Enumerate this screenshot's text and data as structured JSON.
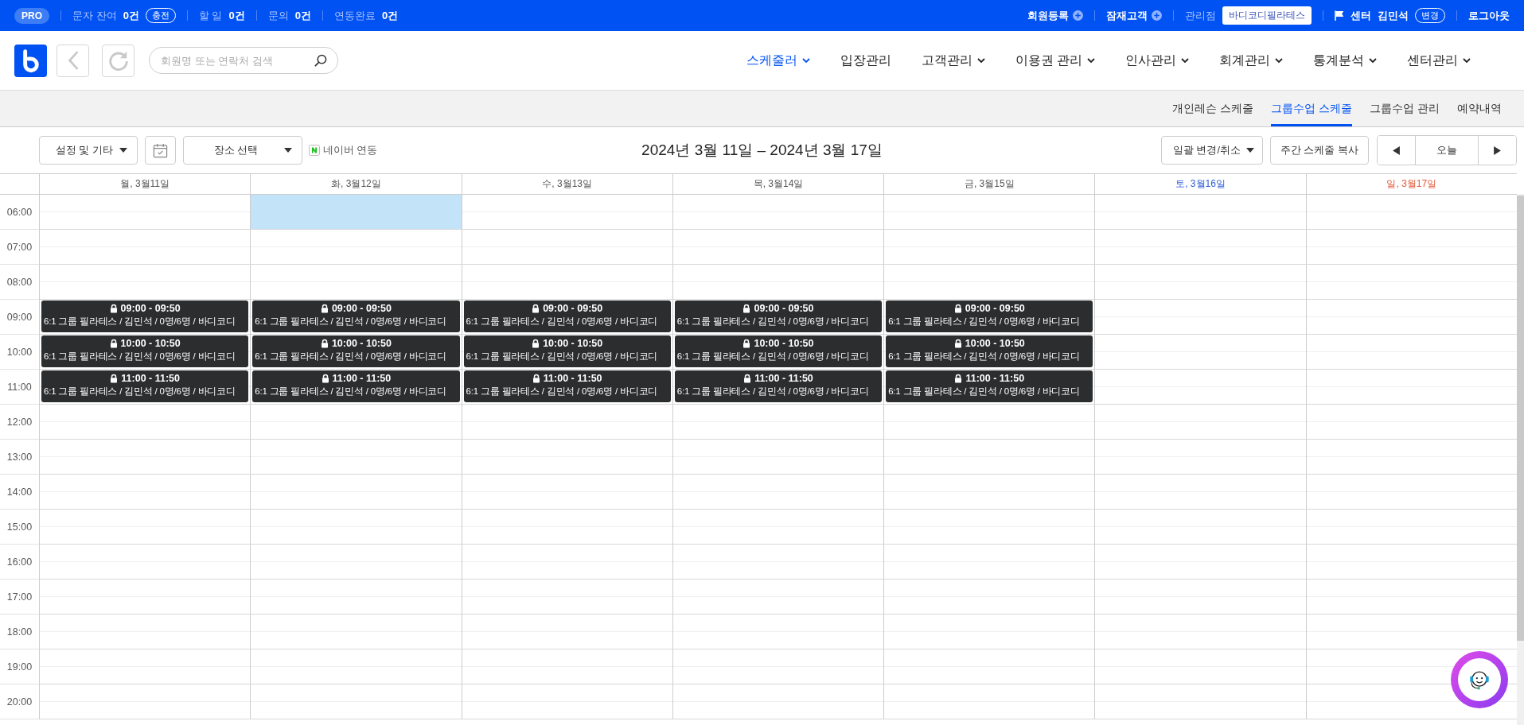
{
  "topbar": {
    "badge": "PRO",
    "stats": [
      {
        "label": "문자 잔여",
        "value": "0건",
        "action": "충전"
      },
      {
        "label": "할 일",
        "value": "0건"
      },
      {
        "label": "문의",
        "value": "0건"
      },
      {
        "label": "연동완료",
        "value": "0건"
      }
    ],
    "links": [
      {
        "label": "회원등록"
      },
      {
        "label": "잠재고객"
      }
    ],
    "branch": {
      "label": "관리점",
      "value": "바디코디필라테스"
    },
    "user": {
      "center": "센터",
      "name": "김민석",
      "action": "변경"
    },
    "logout": "로그아웃"
  },
  "search": {
    "placeholder": "회원명 또는 연락처 검색"
  },
  "nav": [
    {
      "label": "스케줄러",
      "dropdown": true,
      "selected": true
    },
    {
      "label": "입장관리",
      "dropdown": false,
      "selected": false
    },
    {
      "label": "고객관리",
      "dropdown": true,
      "selected": false
    },
    {
      "label": "이용권 관리",
      "dropdown": true,
      "selected": false
    },
    {
      "label": "인사관리",
      "dropdown": true,
      "selected": false
    },
    {
      "label": "회계관리",
      "dropdown": true,
      "selected": false
    },
    {
      "label": "통계분석",
      "dropdown": true,
      "selected": false
    },
    {
      "label": "센터관리",
      "dropdown": true,
      "selected": false
    }
  ],
  "subtabs": [
    {
      "label": "개인레슨 스케줄",
      "selected": false
    },
    {
      "label": "그룹수업 스케줄",
      "selected": true
    },
    {
      "label": "그룹수업 관리",
      "selected": false
    },
    {
      "label": "예약내역",
      "selected": false
    }
  ],
  "toolbar": {
    "settings": "설정 및 기타",
    "place": "장소 선택",
    "naver": "네이버 연동",
    "range": "2024년 3월 11일 – 2024년 3월 17일",
    "bulk": "일괄 변경/취소",
    "copy": "주간 스케줄 복사",
    "today": "오늘"
  },
  "days": [
    {
      "label": "월, 3월11일",
      "kind": "weekday"
    },
    {
      "label": "화, 3월12일",
      "kind": "weekday"
    },
    {
      "label": "수, 3월13일",
      "kind": "weekday"
    },
    {
      "label": "목, 3월14일",
      "kind": "weekday"
    },
    {
      "label": "금, 3월15일",
      "kind": "weekday"
    },
    {
      "label": "토, 3월16일",
      "kind": "saturday"
    },
    {
      "label": "일, 3월17일",
      "kind": "sunday"
    }
  ],
  "hours": [
    {
      "label": "06:00",
      "cells": [
        {
          "selected": false
        },
        {
          "selected": true
        },
        {
          "selected": false
        },
        {
          "selected": false
        },
        {
          "selected": false
        },
        {
          "selected": false
        },
        {
          "selected": false
        }
      ]
    },
    {
      "label": "07:00",
      "cells": [
        {
          "selected": false
        },
        {
          "selected": false
        },
        {
          "selected": false
        },
        {
          "selected": false
        },
        {
          "selected": false
        },
        {
          "selected": false
        },
        {
          "selected": false
        }
      ]
    },
    {
      "label": "08:00",
      "cells": [
        {
          "selected": false
        },
        {
          "selected": false
        },
        {
          "selected": false
        },
        {
          "selected": false
        },
        {
          "selected": false
        },
        {
          "selected": false
        },
        {
          "selected": false
        }
      ]
    },
    {
      "label": "09:00",
      "cells": [
        {
          "selected": false,
          "event": {
            "time": "09:00 - 09:50",
            "title": "6:1 그룹 필라테스 / 김민석 / 0명/6명 / 바디코디",
            "locked": true
          }
        },
        {
          "selected": false,
          "event": {
            "time": "09:00 - 09:50",
            "title": "6:1 그룹 필라테스 / 김민석 / 0명/6명 / 바디코디",
            "locked": true
          }
        },
        {
          "selected": false,
          "event": {
            "time": "09:00 - 09:50",
            "title": "6:1 그룹 필라테스 / 김민석 / 0명/6명 / 바디코디",
            "locked": true
          }
        },
        {
          "selected": false,
          "event": {
            "time": "09:00 - 09:50",
            "title": "6:1 그룹 필라테스 / 김민석 / 0명/6명 / 바디코디",
            "locked": true
          }
        },
        {
          "selected": false,
          "event": {
            "time": "09:00 - 09:50",
            "title": "6:1 그룹 필라테스 / 김민석 / 0명/6명 / 바디코디",
            "locked": true
          }
        },
        {
          "selected": false
        },
        {
          "selected": false
        }
      ]
    },
    {
      "label": "10:00",
      "cells": [
        {
          "selected": false,
          "event": {
            "time": "10:00 - 10:50",
            "title": "6:1 그룹 필라테스 / 김민석 / 0명/6명 / 바디코디",
            "locked": true
          }
        },
        {
          "selected": false,
          "event": {
            "time": "10:00 - 10:50",
            "title": "6:1 그룹 필라테스 / 김민석 / 0명/6명 / 바디코디",
            "locked": true
          }
        },
        {
          "selected": false,
          "event": {
            "time": "10:00 - 10:50",
            "title": "6:1 그룹 필라테스 / 김민석 / 0명/6명 / 바디코디",
            "locked": true
          }
        },
        {
          "selected": false,
          "event": {
            "time": "10:00 - 10:50",
            "title": "6:1 그룹 필라테스 / 김민석 / 0명/6명 / 바디코디",
            "locked": true
          }
        },
        {
          "selected": false,
          "event": {
            "time": "10:00 - 10:50",
            "title": "6:1 그룹 필라테스 / 김민석 / 0명/6명 / 바디코디",
            "locked": true
          }
        },
        {
          "selected": false
        },
        {
          "selected": false
        }
      ]
    },
    {
      "label": "11:00",
      "cells": [
        {
          "selected": false,
          "event": {
            "time": "11:00 - 11:50",
            "title": "6:1 그룹 필라테스 / 김민석 / 0명/6명 / 바디코디",
            "locked": true
          }
        },
        {
          "selected": false,
          "event": {
            "time": "11:00 - 11:50",
            "title": "6:1 그룹 필라테스 / 김민석 / 0명/6명 / 바디코디",
            "locked": true
          }
        },
        {
          "selected": false,
          "event": {
            "time": "11:00 - 11:50",
            "title": "6:1 그룹 필라테스 / 김민석 / 0명/6명 / 바디코디",
            "locked": true
          }
        },
        {
          "selected": false,
          "event": {
            "time": "11:00 - 11:50",
            "title": "6:1 그룹 필라테스 / 김민석 / 0명/6명 / 바디코디",
            "locked": true
          }
        },
        {
          "selected": false,
          "event": {
            "time": "11:00 - 11:50",
            "title": "6:1 그룹 필라테스 / 김민석 / 0명/6명 / 바디코디",
            "locked": true
          }
        },
        {
          "selected": false
        },
        {
          "selected": false
        }
      ]
    },
    {
      "label": "12:00",
      "cells": [
        {
          "selected": false
        },
        {
          "selected": false
        },
        {
          "selected": false
        },
        {
          "selected": false
        },
        {
          "selected": false
        },
        {
          "selected": false
        },
        {
          "selected": false
        }
      ]
    },
    {
      "label": "13:00",
      "cells": [
        {
          "selected": false
        },
        {
          "selected": false
        },
        {
          "selected": false
        },
        {
          "selected": false
        },
        {
          "selected": false
        },
        {
          "selected": false
        },
        {
          "selected": false
        }
      ]
    },
    {
      "label": "14:00",
      "cells": [
        {
          "selected": false
        },
        {
          "selected": false
        },
        {
          "selected": false
        },
        {
          "selected": false
        },
        {
          "selected": false
        },
        {
          "selected": false
        },
        {
          "selected": false
        }
      ]
    },
    {
      "label": "15:00",
      "cells": [
        {
          "selected": false
        },
        {
          "selected": false
        },
        {
          "selected": false
        },
        {
          "selected": false
        },
        {
          "selected": false
        },
        {
          "selected": false
        },
        {
          "selected": false
        }
      ]
    },
    {
      "label": "16:00",
      "cells": [
        {
          "selected": false
        },
        {
          "selected": false
        },
        {
          "selected": false
        },
        {
          "selected": false
        },
        {
          "selected": false
        },
        {
          "selected": false
        },
        {
          "selected": false
        }
      ]
    },
    {
      "label": "17:00",
      "cells": [
        {
          "selected": false
        },
        {
          "selected": false
        },
        {
          "selected": false
        },
        {
          "selected": false
        },
        {
          "selected": false
        },
        {
          "selected": false
        },
        {
          "selected": false
        }
      ]
    },
    {
      "label": "18:00",
      "cells": [
        {
          "selected": false
        },
        {
          "selected": false
        },
        {
          "selected": false
        },
        {
          "selected": false
        },
        {
          "selected": false
        },
        {
          "selected": false
        },
        {
          "selected": false
        }
      ]
    },
    {
      "label": "19:00",
      "cells": [
        {
          "selected": false
        },
        {
          "selected": false
        },
        {
          "selected": false
        },
        {
          "selected": false
        },
        {
          "selected": false
        },
        {
          "selected": false
        },
        {
          "selected": false
        }
      ]
    },
    {
      "label": "20:00",
      "cells": [
        {
          "selected": false
        },
        {
          "selected": false
        },
        {
          "selected": false
        },
        {
          "selected": false
        },
        {
          "selected": false
        },
        {
          "selected": false
        },
        {
          "selected": false
        }
      ]
    }
  ]
}
